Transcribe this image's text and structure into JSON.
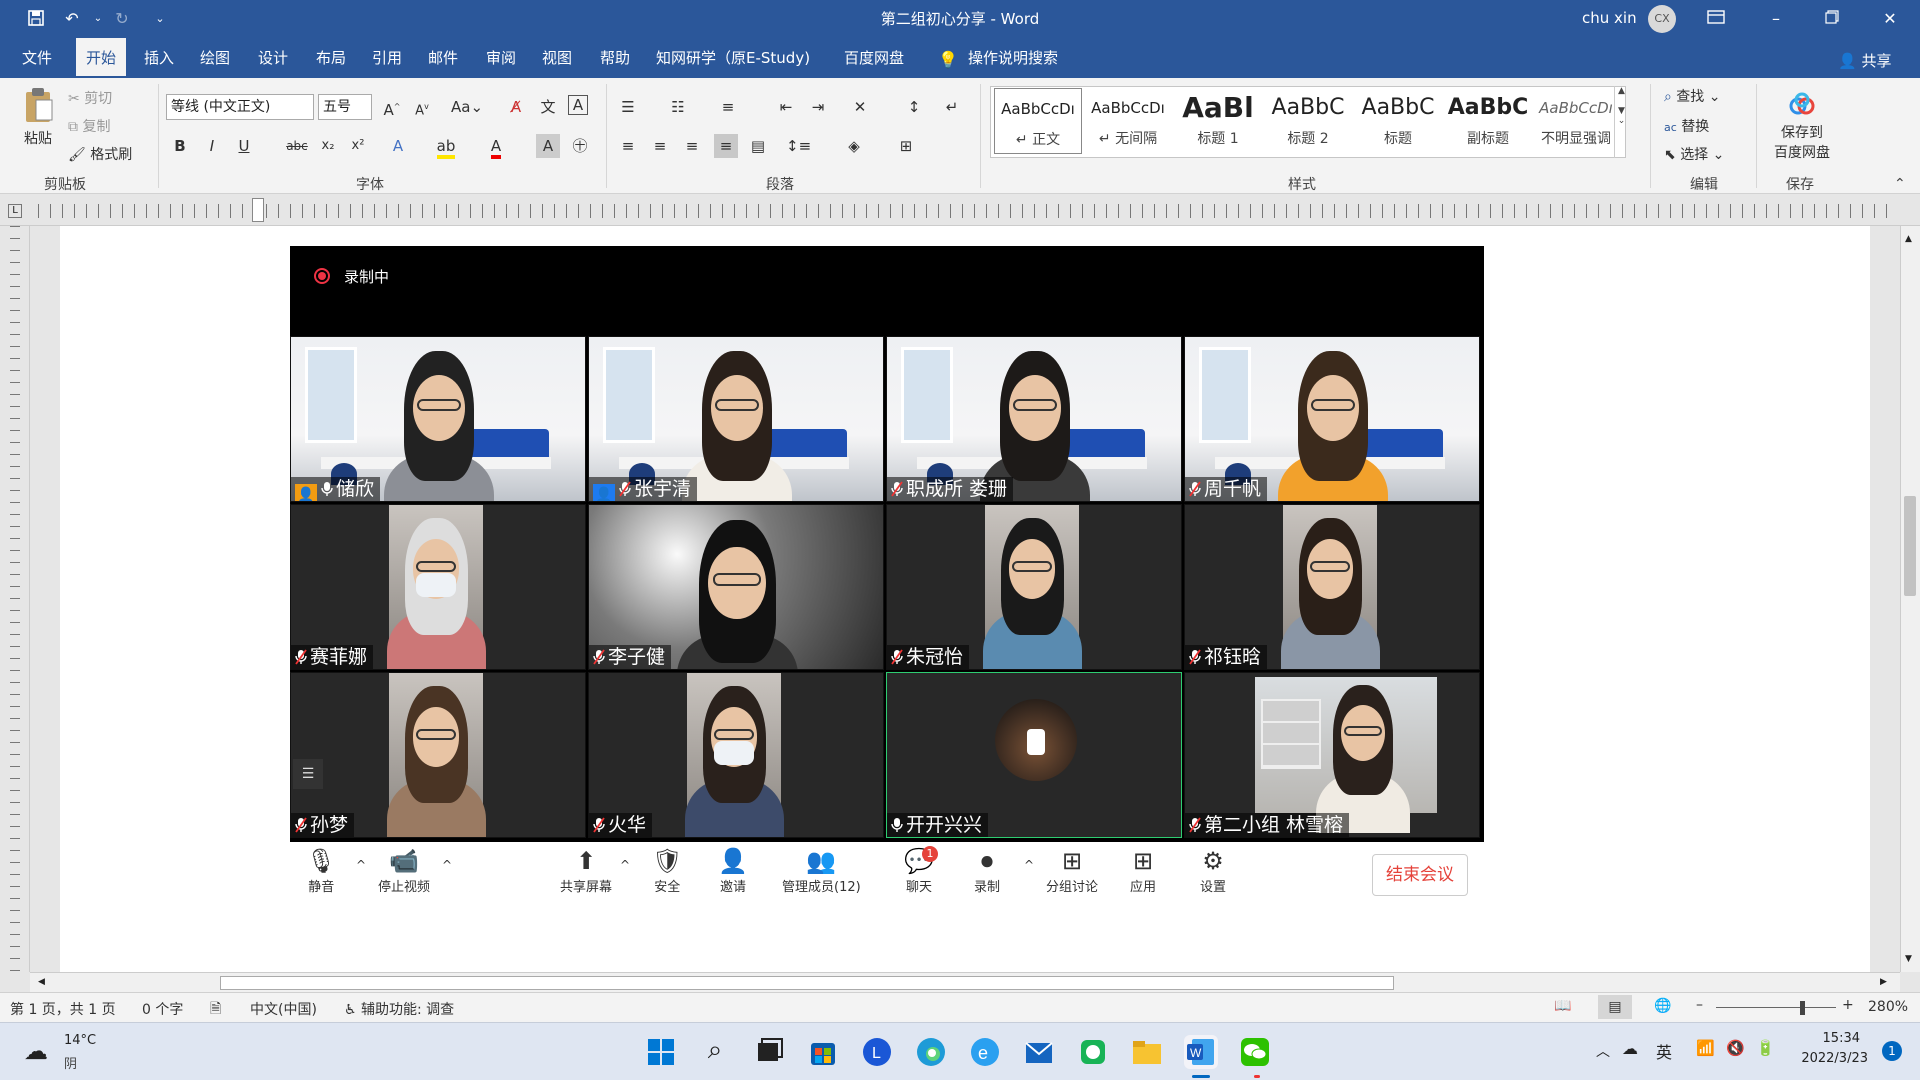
{
  "titlebar": {
    "doc_title": "第二组初心分享 - Word",
    "user_name": "chu xin",
    "user_initials": "CX"
  },
  "tabs": [
    "文件",
    "开始",
    "插入",
    "绘图",
    "设计",
    "布局",
    "引用",
    "邮件",
    "审阅",
    "视图",
    "帮助",
    "知网研学（原E-Study)",
    "百度网盘"
  ],
  "tell_me": "操作说明搜索",
  "share": "共享",
  "ribbon": {
    "clipboard": {
      "paste": "粘贴",
      "cut": "剪切",
      "copy": "复制",
      "format_painter": "格式刷",
      "group": "剪贴板"
    },
    "font": {
      "name": "等线 (中文正文)",
      "size": "五号",
      "group": "字体"
    },
    "paragraph": {
      "group": "段落"
    },
    "styles": {
      "group": "样式",
      "items": [
        {
          "sample": "AaBbCcDı",
          "name": "↵ 正文"
        },
        {
          "sample": "AaBbCcDı",
          "name": "↵ 无间隔"
        },
        {
          "sample": "AaBl",
          "name": "标题 1"
        },
        {
          "sample": "AaBbC",
          "name": "标题 2"
        },
        {
          "sample": "AaBbC",
          "name": "标题"
        },
        {
          "sample": "AaBbC",
          "name": "副标题"
        },
        {
          "sample": "AaBbCcDı",
          "name": "不明显强调"
        }
      ]
    },
    "editing": {
      "find": "查找",
      "replace": "替换",
      "select": "选择",
      "group": "编辑"
    },
    "save": {
      "label1": "保存到",
      "label2": "百度网盘",
      "group": "保存"
    }
  },
  "meeting": {
    "recording": "录制中",
    "tiles": [
      {
        "name": "储欣"
      },
      {
        "name": "张宇清"
      },
      {
        "name": "职成所 娄珊"
      },
      {
        "name": "周千帆"
      },
      {
        "name": "赛菲娜"
      },
      {
        "name": "李子健"
      },
      {
        "name": "朱冠怡"
      },
      {
        "name": "祁钰晗"
      },
      {
        "name": "孙梦"
      },
      {
        "name": "火华"
      },
      {
        "name": "开开兴兴"
      },
      {
        "name": "第二小组 林雪榕"
      }
    ],
    "controls": {
      "mute": "静音",
      "stop_video": "停止视频",
      "share": "共享屏幕",
      "security": "安全",
      "invite": "邀请",
      "participants": "管理成员(12)",
      "chat": "聊天",
      "chat_badge": "1",
      "record": "录制",
      "breakout": "分组讨论",
      "apps": "应用",
      "settings": "设置",
      "end": "结束会议"
    }
  },
  "status": {
    "page": "第 1 页，共 1 页",
    "words": "0 个字",
    "language": "中文(中国)",
    "accessibility": "辅助功能: 调查",
    "zoom": "280%"
  },
  "taskbar": {
    "temp": "14°C",
    "weather": "阴",
    "ime": "英",
    "time": "15:34",
    "date": "2022/3/23",
    "notif": "1"
  },
  "colors": {
    "word_blue": "#2b579a",
    "end_red": "#e5423a"
  }
}
